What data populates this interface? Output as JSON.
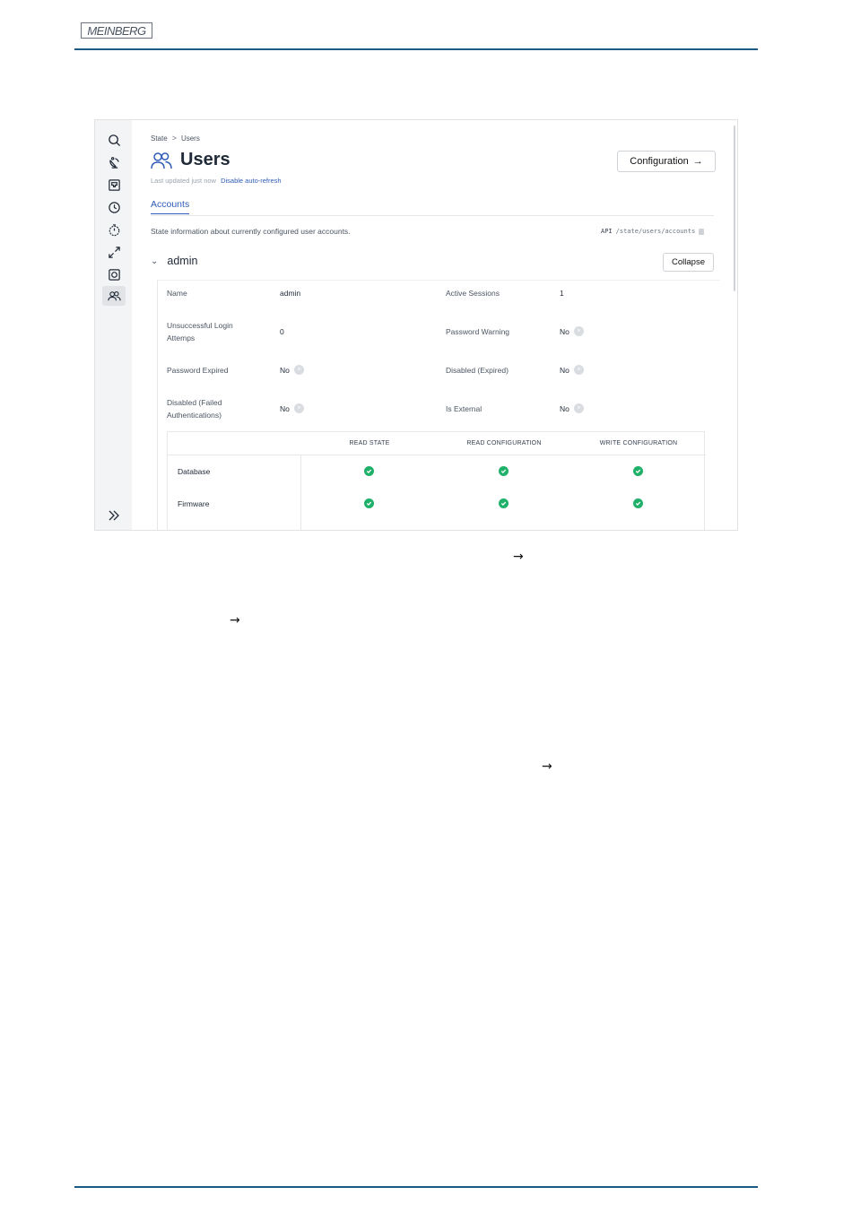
{
  "document": {
    "logo_text": "MEINBERG",
    "arrows": [
      "→",
      "→",
      "→"
    ]
  },
  "breadcrumb": {
    "parent": "State",
    "separator": ">",
    "current": "Users"
  },
  "header": {
    "title": "Users",
    "last_updated": "Last updated just now",
    "refresh_link": "Disable auto-refresh",
    "config_button": "Configuration",
    "config_arrow": "→"
  },
  "tabs": [
    {
      "label": "Accounts",
      "active": true
    }
  ],
  "info_text": "State information about currently configured user accounts.",
  "api": {
    "label": "API",
    "path": "/state/users/accounts"
  },
  "account": {
    "chevron": "⌄",
    "name": "admin",
    "collapse_button": "Collapse",
    "fields": {
      "name": {
        "label": "Name",
        "value": "admin"
      },
      "active_sessions": {
        "label": "Active Sessions",
        "value": "1"
      },
      "unsuccessful_logins": {
        "label_line1": "Unsuccessful Login",
        "label_line2": "Attemps",
        "value": "0"
      },
      "password_warning": {
        "label": "Password Warning",
        "value": "No"
      },
      "password_expired": {
        "label": "Password Expired",
        "value": "No"
      },
      "disabled_expired": {
        "label": "Disabled (Expired)",
        "value": "No"
      },
      "disabled_failed": {
        "label_line1": "Disabled (Failed",
        "label_line2": "Authentications)",
        "value": "No"
      },
      "is_external": {
        "label": "Is External",
        "value": "No"
      }
    },
    "x_glyph": "×"
  },
  "permissions": {
    "columns": [
      "READ STATE",
      "READ CONFIGURATION",
      "WRITE CONFIGURATION"
    ],
    "rows": [
      {
        "label": "Database",
        "read_state": true,
        "read_config": true,
        "write_config": true
      },
      {
        "label": "Firmware",
        "read_state": true,
        "read_config": true,
        "write_config": true
      }
    ]
  },
  "colors": {
    "accent": "#2f5bb7",
    "check": "#1fb06a",
    "rule": "#1b5b86"
  },
  "sidebar_icons": [
    "search-icon",
    "satellite-dish-icon",
    "network-port-icon",
    "clock-icon",
    "stopwatch-icon",
    "expand-arrows-icon",
    "disk-icon",
    "users-icon",
    "double-chevron-right-icon"
  ]
}
